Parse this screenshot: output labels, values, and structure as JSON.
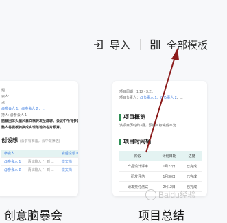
{
  "toolbar": {
    "import_label": "导入",
    "templates_label": "全部模板",
    "import_icon": "import-icon",
    "templates_icon": "template-grid-icon"
  },
  "left_card": {
    "line1": "题:",
    "line2": "会人:",
    "line3": "点:",
    "line4_mentions": "@参会人 1、@参会人 2 、...",
    "line5": "持人: @参会人 1",
    "line6": "脑暴团体头脑风暴文档转发至群聊。会议中所有参会人",
    "line7": "整人将模板转换成实现落地的名片预算。",
    "section_title": "创设想",
    "section_note": "(会前有准备，会中做筛选)",
    "table_rows": [
      {
        "a": "参会人",
        "b": "",
        "c": "会后设想 ①"
      },
      {
        "a": "@参会人 1",
        "b": "请试输入 ^↓ 到 ...",
        "c": "微文档"
      },
      {
        "a": "@参会人 2",
        "b": "请试输入 ^↓ 到 ...",
        "c": "微文档"
      }
    ]
  },
  "right_card": {
    "meta_period": "项目周期：1.12 - 3.21",
    "meta_owner": "项目负责人：@负责人 1、@负责人 2、...",
    "heading_overview": "项目概览",
    "overview_text": "该项目历时约3月，预期目标完成率为.............",
    "heading_timeline": "项目时间轴",
    "table_headers": [
      "阶段",
      "计划日期",
      "进度"
    ],
    "table_rows": [
      [
        "产品设计评审",
        "1月22日",
        "已完成"
      ],
      [
        "研发评估",
        "1月30日",
        "已完成"
      ],
      [
        "研发交付测试",
        "2月12日",
        "已完成"
      ]
    ]
  },
  "titles": {
    "left": "创意脑暴会",
    "right": "项目总结"
  },
  "watermark": {
    "text": "Baidu经验"
  },
  "colors": {
    "arrow": "#8b1a1a",
    "accent_green": "#2f8f55",
    "mention_blue": "#3b7be0"
  }
}
